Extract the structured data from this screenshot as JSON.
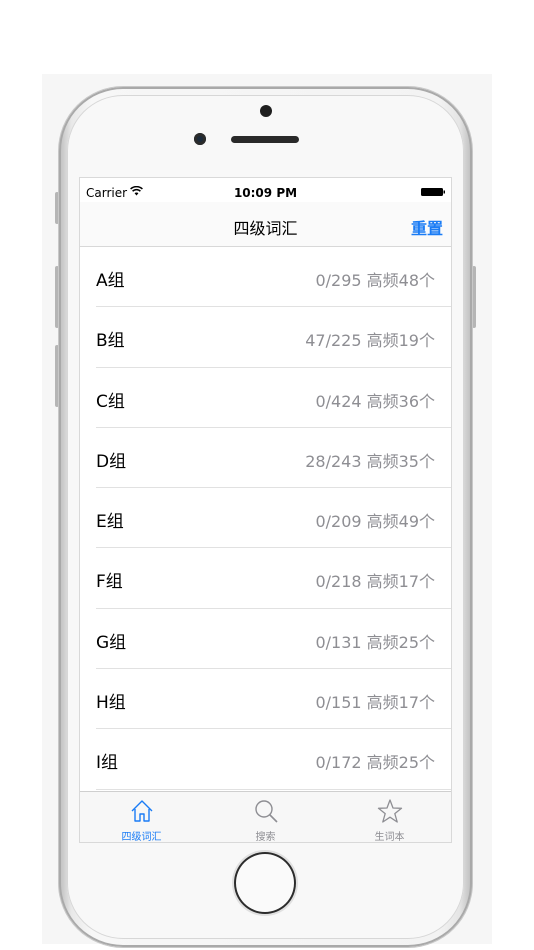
{
  "statusbar": {
    "carrier": "Carrier",
    "time": "10:09 PM"
  },
  "navbar": {
    "title": "四级词汇",
    "reset_label": "重置"
  },
  "groups": [
    {
      "title": "A组",
      "detail": "0/295 高频48个"
    },
    {
      "title": "B组",
      "detail": "47/225 高频19个"
    },
    {
      "title": "C组",
      "detail": "0/424 高频36个"
    },
    {
      "title": "D组",
      "detail": "28/243 高频35个"
    },
    {
      "title": "E组",
      "detail": "0/209 高频49个"
    },
    {
      "title": "F组",
      "detail": "0/218 高频17个"
    },
    {
      "title": "G组",
      "detail": "0/131 高频25个"
    },
    {
      "title": "H组",
      "detail": "0/151 高频17个"
    },
    {
      "title": "I组",
      "detail": "0/172 高频25个"
    }
  ],
  "tabs": [
    {
      "label": "四级词汇",
      "icon": "home-icon",
      "selected": true
    },
    {
      "label": "搜索",
      "icon": "search-icon",
      "selected": false
    },
    {
      "label": "生词本",
      "icon": "star-icon",
      "selected": false
    }
  ],
  "colors": {
    "accent": "#1a7cf5",
    "detail_text": "#8e8e93"
  }
}
